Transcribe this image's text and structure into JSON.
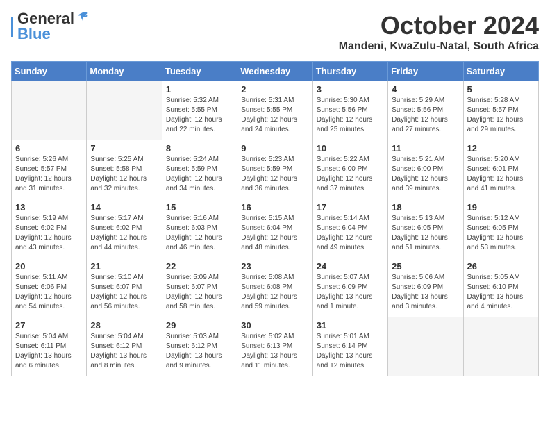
{
  "header": {
    "logo": {
      "part1": "General",
      "part2": "Blue"
    },
    "title": "October 2024",
    "location": "Mandeni, KwaZulu-Natal, South Africa"
  },
  "weekdays": [
    "Sunday",
    "Monday",
    "Tuesday",
    "Wednesday",
    "Thursday",
    "Friday",
    "Saturday"
  ],
  "weeks": [
    [
      {
        "day": "",
        "info": ""
      },
      {
        "day": "",
        "info": ""
      },
      {
        "day": "1",
        "info": "Sunrise: 5:32 AM\nSunset: 5:55 PM\nDaylight: 12 hours\nand 22 minutes."
      },
      {
        "day": "2",
        "info": "Sunrise: 5:31 AM\nSunset: 5:55 PM\nDaylight: 12 hours\nand 24 minutes."
      },
      {
        "day": "3",
        "info": "Sunrise: 5:30 AM\nSunset: 5:56 PM\nDaylight: 12 hours\nand 25 minutes."
      },
      {
        "day": "4",
        "info": "Sunrise: 5:29 AM\nSunset: 5:56 PM\nDaylight: 12 hours\nand 27 minutes."
      },
      {
        "day": "5",
        "info": "Sunrise: 5:28 AM\nSunset: 5:57 PM\nDaylight: 12 hours\nand 29 minutes."
      }
    ],
    [
      {
        "day": "6",
        "info": "Sunrise: 5:26 AM\nSunset: 5:57 PM\nDaylight: 12 hours\nand 31 minutes."
      },
      {
        "day": "7",
        "info": "Sunrise: 5:25 AM\nSunset: 5:58 PM\nDaylight: 12 hours\nand 32 minutes."
      },
      {
        "day": "8",
        "info": "Sunrise: 5:24 AM\nSunset: 5:59 PM\nDaylight: 12 hours\nand 34 minutes."
      },
      {
        "day": "9",
        "info": "Sunrise: 5:23 AM\nSunset: 5:59 PM\nDaylight: 12 hours\nand 36 minutes."
      },
      {
        "day": "10",
        "info": "Sunrise: 5:22 AM\nSunset: 6:00 PM\nDaylight: 12 hours\nand 37 minutes."
      },
      {
        "day": "11",
        "info": "Sunrise: 5:21 AM\nSunset: 6:00 PM\nDaylight: 12 hours\nand 39 minutes."
      },
      {
        "day": "12",
        "info": "Sunrise: 5:20 AM\nSunset: 6:01 PM\nDaylight: 12 hours\nand 41 minutes."
      }
    ],
    [
      {
        "day": "13",
        "info": "Sunrise: 5:19 AM\nSunset: 6:02 PM\nDaylight: 12 hours\nand 43 minutes."
      },
      {
        "day": "14",
        "info": "Sunrise: 5:17 AM\nSunset: 6:02 PM\nDaylight: 12 hours\nand 44 minutes."
      },
      {
        "day": "15",
        "info": "Sunrise: 5:16 AM\nSunset: 6:03 PM\nDaylight: 12 hours\nand 46 minutes."
      },
      {
        "day": "16",
        "info": "Sunrise: 5:15 AM\nSunset: 6:04 PM\nDaylight: 12 hours\nand 48 minutes."
      },
      {
        "day": "17",
        "info": "Sunrise: 5:14 AM\nSunset: 6:04 PM\nDaylight: 12 hours\nand 49 minutes."
      },
      {
        "day": "18",
        "info": "Sunrise: 5:13 AM\nSunset: 6:05 PM\nDaylight: 12 hours\nand 51 minutes."
      },
      {
        "day": "19",
        "info": "Sunrise: 5:12 AM\nSunset: 6:05 PM\nDaylight: 12 hours\nand 53 minutes."
      }
    ],
    [
      {
        "day": "20",
        "info": "Sunrise: 5:11 AM\nSunset: 6:06 PM\nDaylight: 12 hours\nand 54 minutes."
      },
      {
        "day": "21",
        "info": "Sunrise: 5:10 AM\nSunset: 6:07 PM\nDaylight: 12 hours\nand 56 minutes."
      },
      {
        "day": "22",
        "info": "Sunrise: 5:09 AM\nSunset: 6:07 PM\nDaylight: 12 hours\nand 58 minutes."
      },
      {
        "day": "23",
        "info": "Sunrise: 5:08 AM\nSunset: 6:08 PM\nDaylight: 12 hours\nand 59 minutes."
      },
      {
        "day": "24",
        "info": "Sunrise: 5:07 AM\nSunset: 6:09 PM\nDaylight: 13 hours\nand 1 minute."
      },
      {
        "day": "25",
        "info": "Sunrise: 5:06 AM\nSunset: 6:09 PM\nDaylight: 13 hours\nand 3 minutes."
      },
      {
        "day": "26",
        "info": "Sunrise: 5:05 AM\nSunset: 6:10 PM\nDaylight: 13 hours\nand 4 minutes."
      }
    ],
    [
      {
        "day": "27",
        "info": "Sunrise: 5:04 AM\nSunset: 6:11 PM\nDaylight: 13 hours\nand 6 minutes."
      },
      {
        "day": "28",
        "info": "Sunrise: 5:04 AM\nSunset: 6:12 PM\nDaylight: 13 hours\nand 8 minutes."
      },
      {
        "day": "29",
        "info": "Sunrise: 5:03 AM\nSunset: 6:12 PM\nDaylight: 13 hours\nand 9 minutes."
      },
      {
        "day": "30",
        "info": "Sunrise: 5:02 AM\nSunset: 6:13 PM\nDaylight: 13 hours\nand 11 minutes."
      },
      {
        "day": "31",
        "info": "Sunrise: 5:01 AM\nSunset: 6:14 PM\nDaylight: 13 hours\nand 12 minutes."
      },
      {
        "day": "",
        "info": ""
      },
      {
        "day": "",
        "info": ""
      }
    ]
  ]
}
